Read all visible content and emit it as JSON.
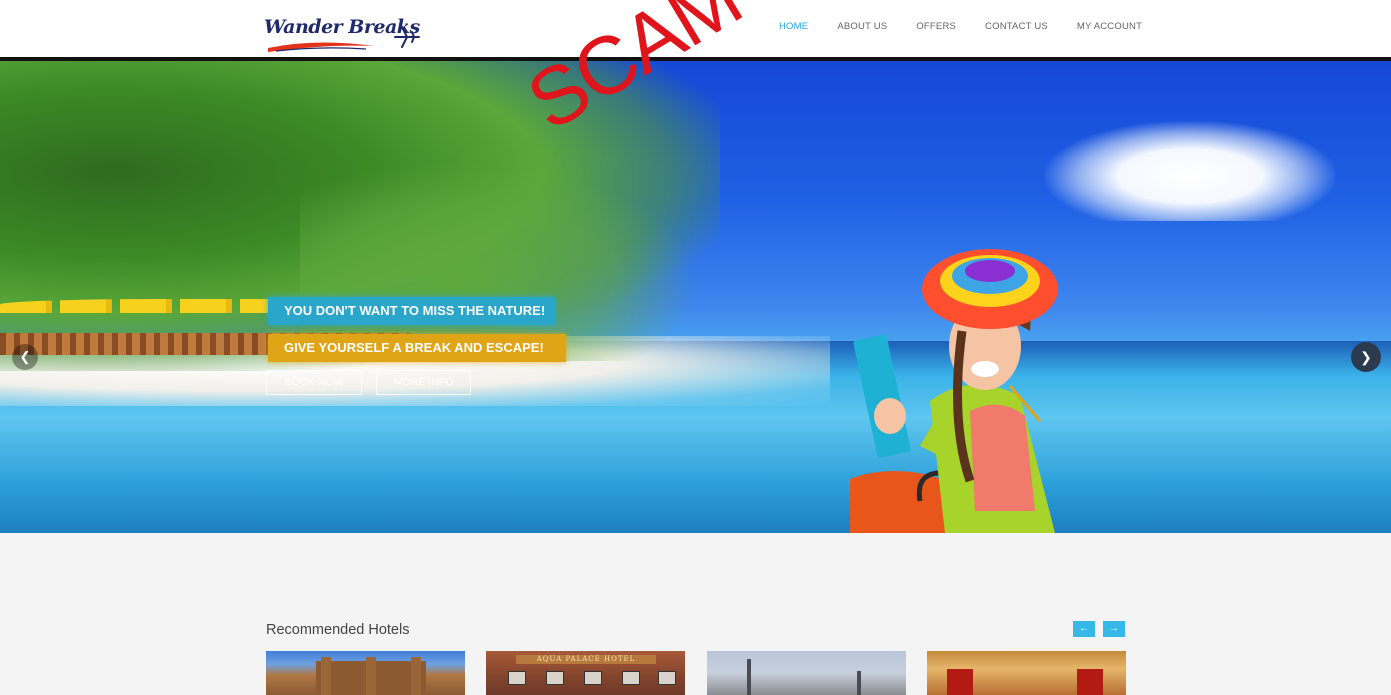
{
  "header": {
    "logo_text": "Wander Breaks",
    "nav": [
      {
        "label": "HOME",
        "active": true
      },
      {
        "label": "ABOUT US",
        "active": false
      },
      {
        "label": "OFFERS",
        "active": false
      },
      {
        "label": "CONTACT US",
        "active": false
      },
      {
        "label": "MY ACCOUNT",
        "active": false
      }
    ]
  },
  "hero": {
    "caption_primary": "YOU DON'T WANT TO MISS THE NATURE!",
    "caption_secondary": "GIVE YOURSELF A BREAK AND ESCAPE!",
    "book_button": "BOOK NOW",
    "info_button": "MORE INFO",
    "prev_icon": "chevron-left-icon",
    "next_icon": "chevron-right-icon",
    "overlay_stamp": "SCAM"
  },
  "recommended": {
    "title": "Recommended Hotels",
    "prev_icon": "arrow-left-icon",
    "next_icon": "arrow-right-icon",
    "hotel_sign_text": "AQUA PALACE HOTEL"
  },
  "colors": {
    "accent": "#1fa7d8",
    "caption_blue": "#29a6c9",
    "caption_gold": "#e0a517",
    "stamp_red": "#e0141b"
  }
}
